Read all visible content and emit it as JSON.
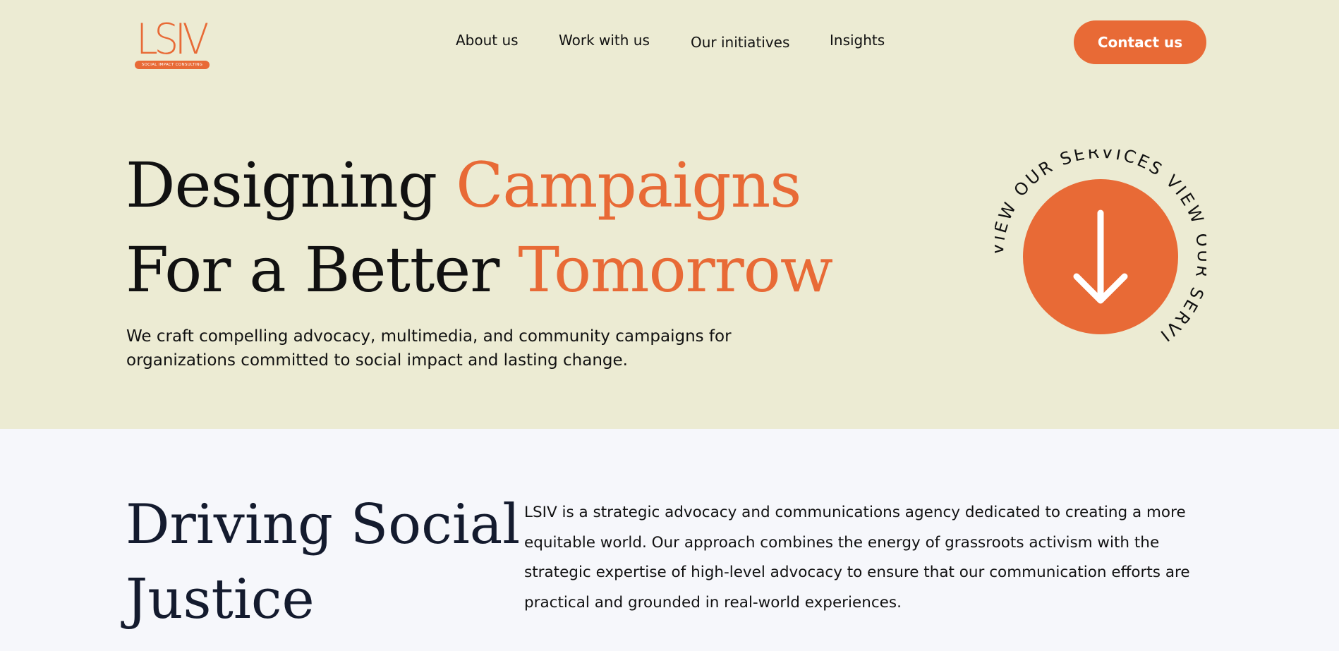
{
  "brand": {
    "logo_text": "LSIV",
    "tagline": "SOCIAL IMPACT CONSULTING",
    "accent_color": "#e86a36",
    "hero_bg": "#ecebd3",
    "section_bg": "#f6f7fb"
  },
  "nav": {
    "items": [
      {
        "label": "About us"
      },
      {
        "label": "Work with us"
      },
      {
        "label": "Our initiatives"
      },
      {
        "label": "Insights"
      }
    ],
    "cta_label": "Contact us"
  },
  "hero": {
    "line1_plain": "Designing",
    "line1_accent": "Campaigns",
    "line2_plain": "For a Better",
    "line2_accent": "Tomorrow",
    "subtitle": "We craft compelling advocacy, multimedia, and community campaigns for organizations committed to social impact and lasting change.",
    "services_ring_text": "VIEW OUR SERVICES VIEW OUR SERVI",
    "services_icon": "arrow-down-icon"
  },
  "about": {
    "title_line1": "Driving Social",
    "title_line2": "Justice",
    "body": "LSIV is a strategic advocacy and communications agency dedicated to creating a more equitable world. Our approach combines the energy of grassroots activism with the strategic expertise of high-level advocacy to ensure that our communication efforts are practical and grounded in real-world experiences."
  }
}
